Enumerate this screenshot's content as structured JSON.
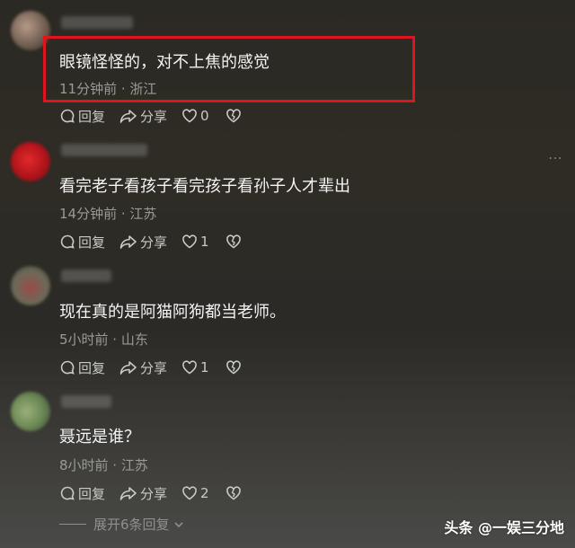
{
  "comments": [
    {
      "text": "眼镜怪怪的，对不上焦的感觉",
      "meta": "11分钟前 · 浙江",
      "reply_label": "回复",
      "share_label": "分享",
      "like_count": "0"
    },
    {
      "text": "看完老子看孩子看完孩子看孙子人才辈出",
      "meta": "14分钟前 · 江苏",
      "reply_label": "回复",
      "share_label": "分享",
      "like_count": "1"
    },
    {
      "text": "现在真的是阿猫阿狗都当老师。",
      "meta": "5小时前 · 山东",
      "reply_label": "回复",
      "share_label": "分享",
      "like_count": "1"
    },
    {
      "text": "聂远是谁？",
      "meta": "8小时前 · 江苏",
      "reply_label": "回复",
      "share_label": "分享",
      "like_count": "2"
    }
  ],
  "expand_replies": "展开6条回复",
  "watermark": "头条 @一娱三分地",
  "colors": {
    "highlight_border": "#e0141c",
    "meta_text": "#9a9a96"
  }
}
